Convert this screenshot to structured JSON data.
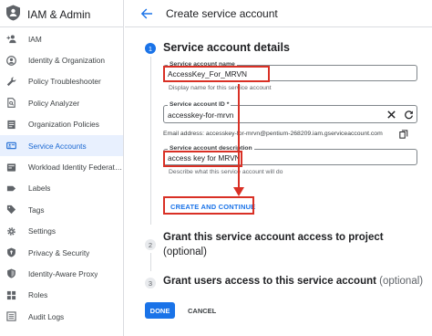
{
  "sidebar": {
    "title": "IAM & Admin",
    "items": [
      {
        "label": "IAM",
        "icon": "person-add-icon"
      },
      {
        "label": "Identity & Organization",
        "icon": "account-circle-icon"
      },
      {
        "label": "Policy Troubleshooter",
        "icon": "wrench-icon"
      },
      {
        "label": "Policy Analyzer",
        "icon": "policy-document-icon"
      },
      {
        "label": "Organization Policies",
        "icon": "list-document-icon"
      },
      {
        "label": "Service Accounts",
        "icon": "service-account-icon",
        "active": true
      },
      {
        "label": "Workload Identity Federat…",
        "icon": "workload-identity-icon"
      },
      {
        "label": "Labels",
        "icon": "label-icon"
      },
      {
        "label": "Tags",
        "icon": "tag-icon"
      },
      {
        "label": "Settings",
        "icon": "gear-icon"
      },
      {
        "label": "Privacy & Security",
        "icon": "shield-icon"
      },
      {
        "label": "Identity-Aware Proxy",
        "icon": "proxy-icon"
      },
      {
        "label": "Roles",
        "icon": "roles-icon"
      },
      {
        "label": "Audit Logs",
        "icon": "audit-logs-icon"
      }
    ]
  },
  "header": {
    "title": "Create service account"
  },
  "steps": [
    {
      "number": "1",
      "title": "Service account details"
    },
    {
      "number": "2",
      "title": "Grant this service account access to project",
      "optional": "(optional)"
    },
    {
      "number": "3",
      "title": "Grant users access to this service account",
      "optional": "(optional)"
    }
  ],
  "form": {
    "name": {
      "label": "Service account name",
      "value": "AccessKey_For_MRVN",
      "hint": "Display name for this service account"
    },
    "id": {
      "label": "Service account ID *",
      "value": "accesskey-for-mrvn",
      "email_text": "Email address: accesskey-for-mrvn@pentium-268209.iam.gserviceaccount.com"
    },
    "description": {
      "label": "Service account description",
      "value": "access key for MRVN",
      "hint": "Describe what this service account will do"
    },
    "create_button": "CREATE AND CONTINUE"
  },
  "actions": {
    "done": "DONE",
    "cancel": "CANCEL"
  },
  "colors": {
    "accent": "#1a73e8",
    "annotation_red": "#d93025",
    "active_nav_bg": "#e8f0fe"
  }
}
